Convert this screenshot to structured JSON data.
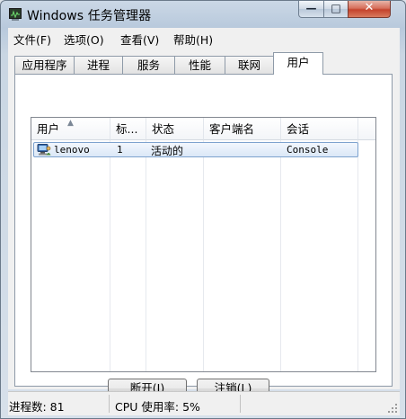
{
  "window": {
    "title": "Windows 任务管理器",
    "icon": "task-manager-icon"
  },
  "caption_buttons": {
    "minimize": "—",
    "maximize": "□",
    "close": "✕"
  },
  "menu": [
    "文件(F)",
    "选项(O)",
    "查看(V)",
    "帮助(H)"
  ],
  "tabs": [
    {
      "label": "应用程序"
    },
    {
      "label": "进程"
    },
    {
      "label": "服务"
    },
    {
      "label": "性能"
    },
    {
      "label": "联网"
    },
    {
      "label": "用户",
      "active": true
    }
  ],
  "user_list": {
    "columns": [
      "用户",
      "标...",
      "状态",
      "客户端名",
      "会话"
    ],
    "sort_column": "用户",
    "rows": [
      {
        "icon": "user-icon",
        "user": "lenovo",
        "id": "1",
        "status": "活动的",
        "client_name": "",
        "session": "Console",
        "selected": true
      }
    ]
  },
  "buttons": {
    "disconnect": "断开(I)",
    "logoff": "注销(L)"
  },
  "status_bar": {
    "processes": "进程数: 81",
    "cpu": "CPU 使用率: 5%"
  }
}
